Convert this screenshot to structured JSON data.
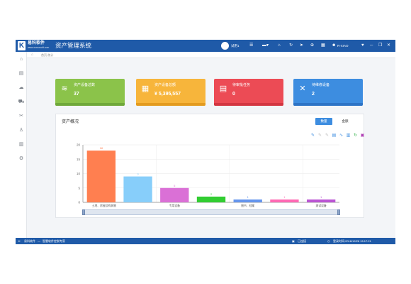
{
  "header": {
    "brand": "易科软件",
    "brand_sub": "www.xxxxxsoft.com",
    "system_title": "资产管理系统",
    "user_name": "试用1",
    "user_role": "R-XIAO",
    "icons": [
      "menu-icon",
      "display-icon",
      "home-icon",
      "refresh-icon",
      "send-icon",
      "lock-icon",
      "calendar-icon",
      "user-icon",
      "heart-icon",
      "minimize-icon",
      "restore-icon",
      "close-icon"
    ]
  },
  "breadcrumb": {
    "text": "首页-统计"
  },
  "sidebar": {
    "items": [
      "home-icon",
      "asset-icon",
      "cloud-icon",
      "cart-icon",
      "tools-icon",
      "person-icon",
      "report-icon",
      "settings-icon"
    ]
  },
  "cards": [
    {
      "label": "资产设备总数",
      "value": "37",
      "color": "#8bc34a",
      "strip": "#6fa83a",
      "icon": "stack-icon"
    },
    {
      "label": "资产设备总额",
      "value": "¥ 5,395,557",
      "color": "#f7b53b",
      "strip": "#e39b1f",
      "icon": "grid-icon"
    },
    {
      "label": "待审批任务",
      "value": "0",
      "color": "#ec4b55",
      "strip": "#d33641",
      "icon": "document-icon"
    },
    {
      "label": "待维修设备",
      "value": "2",
      "color": "#3d8de0",
      "strip": "#2d74c6",
      "icon": "wrench-icon"
    }
  ],
  "panel": {
    "title": "资产概况",
    "tab_quantity": "数量",
    "tab_amount": "金额"
  },
  "statusbar": {
    "company": "易科软件",
    "sep": "—",
    "product": "智慧软件定制专家",
    "online": "已连接",
    "datetime": "登录时间:2016/12/26 15:17:21"
  },
  "chart_data": {
    "type": "bar",
    "categories": [
      "土地、房屋及构筑物",
      "",
      "专用设备",
      "",
      "图书、档案",
      "",
      "测试设备"
    ],
    "values": [
      18,
      9,
      5,
      2,
      1,
      1,
      1
    ],
    "colors": [
      "#ff7f50",
      "#87cefa",
      "#da70d6",
      "#32cd32",
      "#6495ed",
      "#ff69b4",
      "#ba55d3"
    ],
    "ylim": [
      0,
      20
    ],
    "yticks": [
      0,
      5,
      10,
      15,
      20
    ],
    "grid": true
  }
}
